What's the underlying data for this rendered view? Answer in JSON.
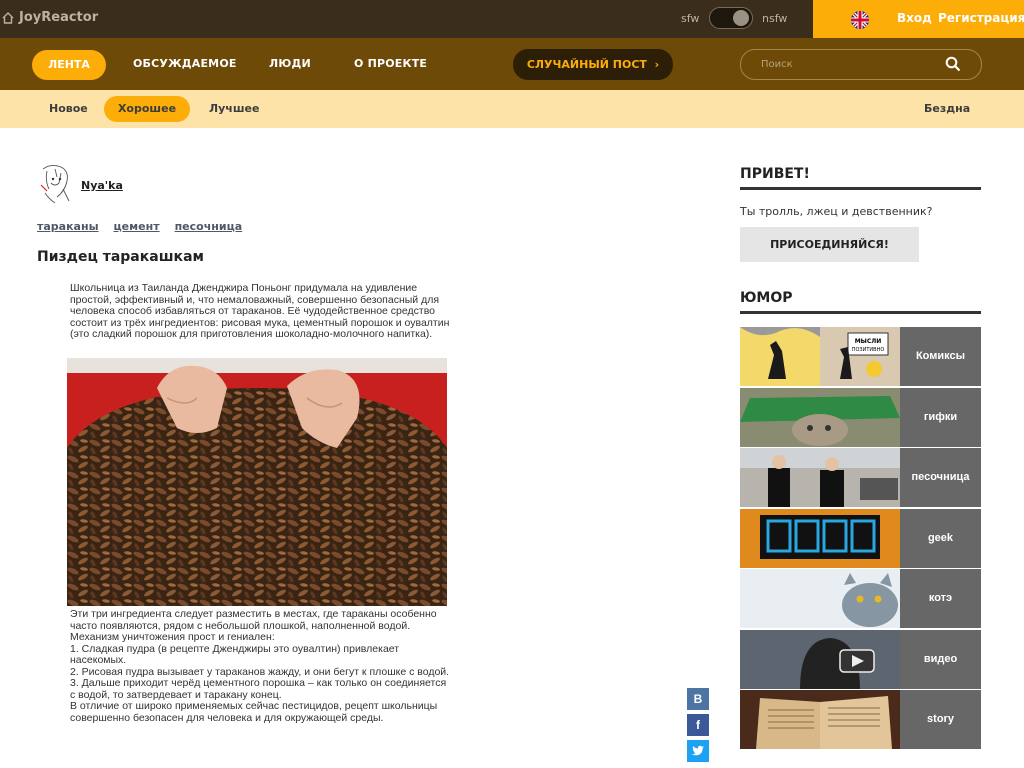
{
  "topbar": {
    "brand": "JoyReactor",
    "sfw_label": "sfw",
    "nsfw_label": "nsfw",
    "login": "Вход",
    "register": "Регистрация"
  },
  "nav": {
    "items": [
      "ЛЕНТА",
      "ОБСУЖДАЕМОЕ",
      "ЛЮДИ",
      "О ПРОЕКТЕ"
    ],
    "random_post": "СЛУЧАЙНЫЙ ПОСТ",
    "search_placeholder": "Поиск"
  },
  "subnav": {
    "items": [
      "Новое",
      "Хорошее",
      "Лучшее"
    ],
    "abyss": "Бездна"
  },
  "post": {
    "author": "Nya'ka",
    "tags": [
      "тараканы",
      "цемент",
      "песочница"
    ],
    "title": "Пиздец таракашкам",
    "text_before": "Школьница из Таиланда Дженджира Поньонг придумала на удивление простой, эффективный и, что немаловажный, совершенно безопасный для человека способ избавляться от тараканов. Её чудодейственное средство состоит из трёх ингредиентов: рисовая мука, цементный порошок и оувалтин (это сладкий порошок для приготовления шоколадно-молочного напитка).",
    "text_after": [
      "Эти три ингредиента следует разместить в местах, где тараканы особенно часто появляются, рядом с небольшой плошкой, наполненной водой.",
      "Механизм уничтожения прост и гениален:",
      "1. Сладкая пудра (в рецепте Дженджиры это оувалтин) привлекает насекомых.",
      "2. Рисовая пудра вызывает у тараканов жажду, и они бегут к плошке с водой.",
      "3. Дальше приходит черёд цементного порошка – как только он соединяется с водой, то затвердевает и таракану конец.",
      "В отличие от широко применяемых сейчас пестицидов, рецепт школьницы совершенно безопасен для человека и для окружающей среды."
    ]
  },
  "share": {
    "vk": "В",
    "fb": "f"
  },
  "sidebar": {
    "hello_title": "ПРИВЕТ!",
    "greeting": "Ты тролль, лжец и девственник?",
    "join_button": "ПРИСОЕДИНЯЙСЯ!",
    "humor_title": "ЮМОР",
    "comic_sign": "МЫСЛИ ПОЗИТИВНО",
    "categories": [
      "Комиксы",
      "гифки",
      "песочница",
      "geek",
      "котэ",
      "видео",
      "story"
    ]
  },
  "colors": {
    "topbar": "#3a2d1c",
    "accent": "#fcad07",
    "nav": "#6e4a08",
    "subnav": "#fde3a7"
  }
}
